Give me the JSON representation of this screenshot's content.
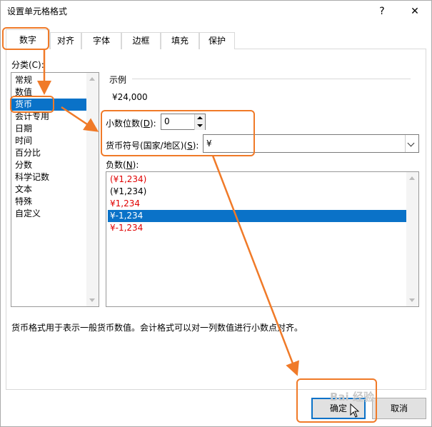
{
  "dialog": {
    "title": "设置单元格格式",
    "help_icon": "?",
    "close_icon": "✕"
  },
  "tabs": [
    {
      "label": "数字",
      "active": true
    },
    {
      "label": "对齐"
    },
    {
      "label": "字体"
    },
    {
      "label": "边框"
    },
    {
      "label": "填充"
    },
    {
      "label": "保护"
    }
  ],
  "category": {
    "label": "分类(C):",
    "items": [
      "常规",
      "数值",
      "货币",
      "会计专用",
      "日期",
      "时间",
      "百分比",
      "分数",
      "科学记数",
      "文本",
      "特殊",
      "自定义"
    ],
    "selected": "货币"
  },
  "sample": {
    "label": "示例",
    "value": "¥24,000"
  },
  "decimal": {
    "label_pre": "小数位数(",
    "label_key": "D",
    "label_post": "):",
    "value": "0"
  },
  "currency_symbol": {
    "label_pre": "货币符号(国家/地区)(",
    "label_key": "S",
    "label_post": "):",
    "value": "¥"
  },
  "negative": {
    "label_pre": "负数(",
    "label_key": "N",
    "label_post": "):",
    "items": [
      {
        "text": "(¥1,234)",
        "red": true
      },
      {
        "text": "(¥1,234)",
        "red": false
      },
      {
        "text": "¥1,234",
        "red": true
      },
      {
        "text": "¥-1,234",
        "red": false,
        "selected": true
      },
      {
        "text": "¥-1,234",
        "red": true
      }
    ]
  },
  "description": "货币格式用于表示一般货币数值。会计格式可以对一列数值进行小数点对齐。",
  "buttons": {
    "ok": "确定",
    "cancel": "取消"
  },
  "watermark": "Bai 经验",
  "annotation_color": "#f07a28"
}
